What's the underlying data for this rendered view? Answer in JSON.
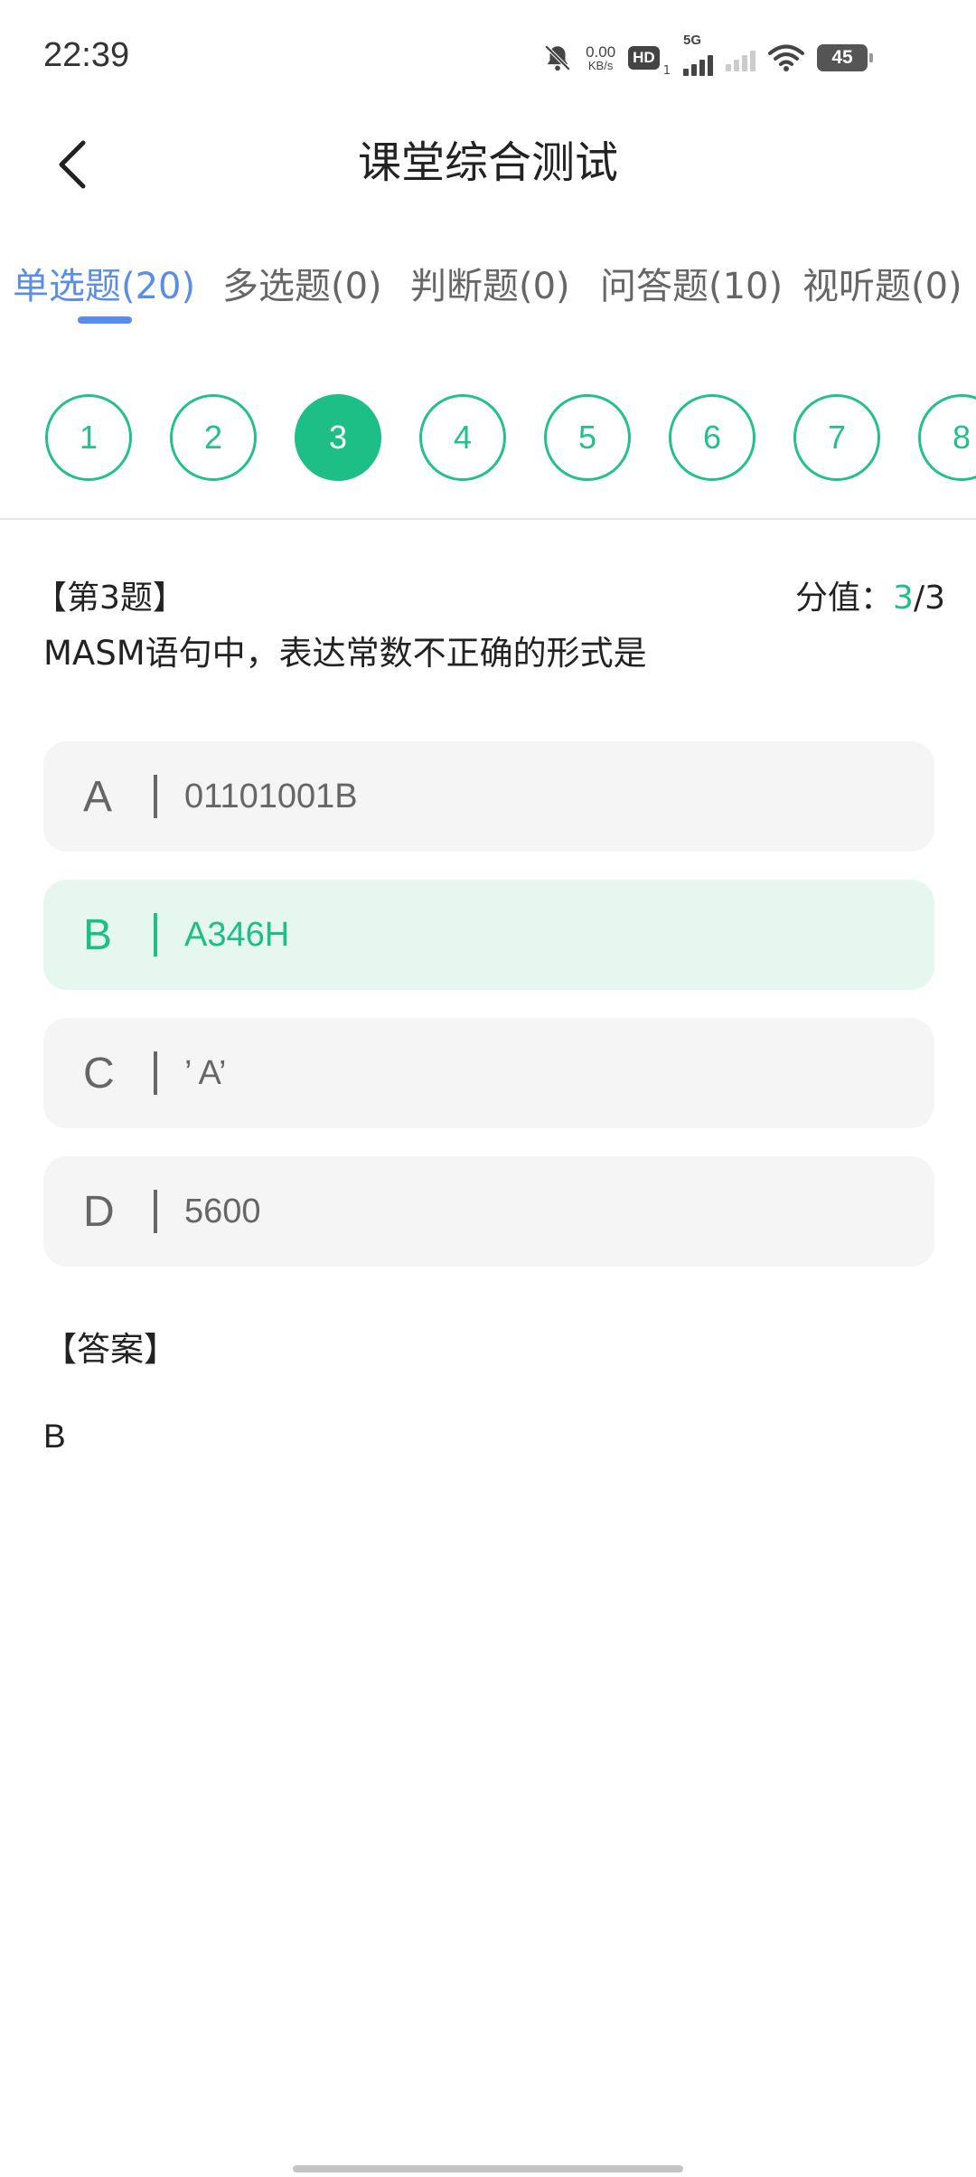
{
  "status_bar": {
    "time": "22:39",
    "net_speed_value": "0.00",
    "net_speed_unit": "KB/s",
    "hd_label": "HD",
    "hd_sub": "1",
    "network_label": "5G",
    "battery": "45",
    "icons": [
      "mute-bell-icon",
      "hd-icon",
      "5g-signal-icon",
      "signal-icon",
      "wifi-icon",
      "battery-icon"
    ]
  },
  "header": {
    "title": "课堂综合测试",
    "back_icon": "chevron-left-icon"
  },
  "tabs": [
    {
      "label": "单选题(20)",
      "active": true
    },
    {
      "label": "多选题(0)",
      "active": false
    },
    {
      "label": "判断题(0)",
      "active": false
    },
    {
      "label": "问答题(10)",
      "active": false
    },
    {
      "label": "视听题(0)",
      "active": false
    }
  ],
  "question_numbers": [
    "1",
    "2",
    "3",
    "4",
    "5",
    "6",
    "7",
    "8"
  ],
  "current_question": "3",
  "question": {
    "number_label": "【第3题】",
    "score_prefix": "分值：",
    "score_obtained": "3",
    "score_total": "/3",
    "text": "MASM语句中，表达常数不正确的形式是"
  },
  "options": [
    {
      "letter": "A",
      "text": "01101001B",
      "selected": false
    },
    {
      "letter": "B",
      "text": "A346H",
      "selected": true
    },
    {
      "letter": "C",
      "text": "’ A’",
      "selected": false
    },
    {
      "letter": "D",
      "text": "5600",
      "selected": false
    }
  ],
  "answer": {
    "label": "【答案】",
    "value": "B"
  },
  "colors": {
    "accent_green": "#1dbf86",
    "tab_active_blue": "#5b8de6",
    "option_bg": "#f5f5f5",
    "option_selected_bg": "#e5f7ef"
  }
}
